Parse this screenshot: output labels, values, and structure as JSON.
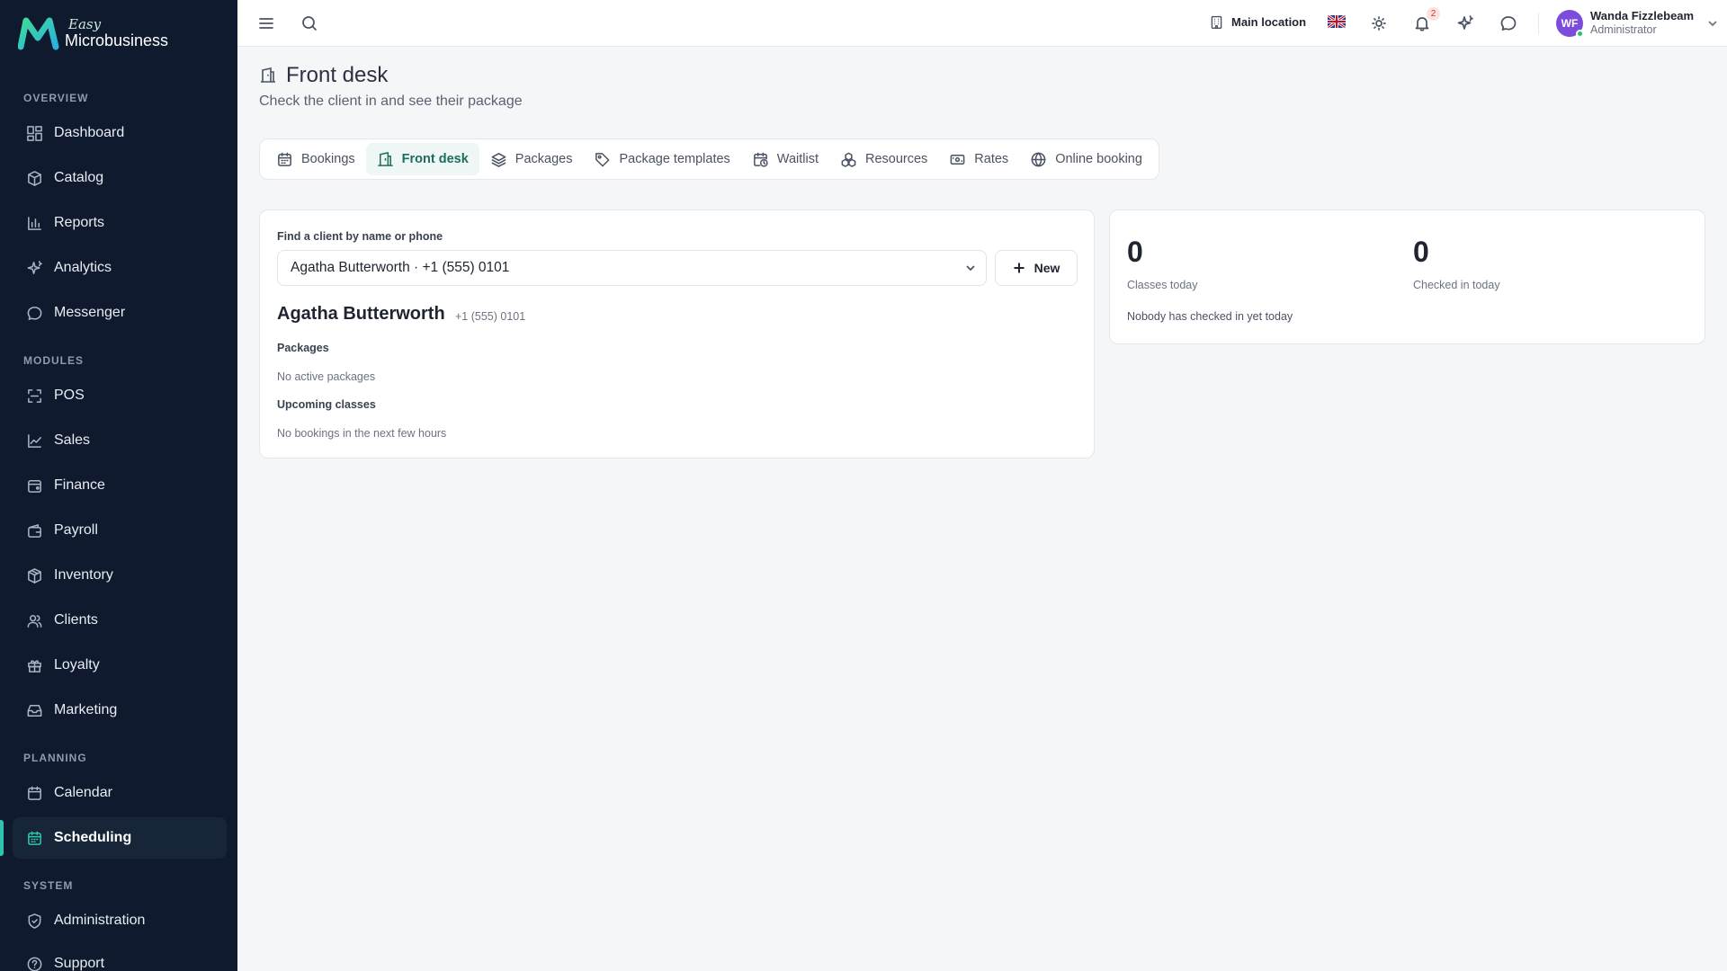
{
  "brand": {
    "easy": "Easy",
    "name": "Microbusiness"
  },
  "sidebar": {
    "sections": {
      "overview": "OVERVIEW",
      "modules": "MODULES",
      "planning": "PLANNING",
      "system": "SYSTEM"
    },
    "items": [
      {
        "label": "Dashboard",
        "icon": "dashboard-icon"
      },
      {
        "label": "Catalog",
        "icon": "catalog-icon"
      },
      {
        "label": "Reports",
        "icon": "reports-icon"
      },
      {
        "label": "Analytics",
        "icon": "analytics-icon"
      },
      {
        "label": "Messenger",
        "icon": "messenger-icon"
      },
      {
        "label": "POS",
        "icon": "pos-icon"
      },
      {
        "label": "Sales",
        "icon": "sales-icon"
      },
      {
        "label": "Finance",
        "icon": "finance-icon"
      },
      {
        "label": "Payroll",
        "icon": "payroll-icon"
      },
      {
        "label": "Inventory",
        "icon": "inventory-icon"
      },
      {
        "label": "Clients",
        "icon": "clients-icon"
      },
      {
        "label": "Loyalty",
        "icon": "loyalty-icon"
      },
      {
        "label": "Marketing",
        "icon": "marketing-icon"
      },
      {
        "label": "Calendar",
        "icon": "calendar-icon"
      },
      {
        "label": "Scheduling",
        "icon": "scheduling-icon",
        "active": true
      },
      {
        "label": "Administration",
        "icon": "shield-icon"
      },
      {
        "label": "Support",
        "icon": "help-icon"
      }
    ]
  },
  "topbar": {
    "location": "Main location",
    "notifications_count": "2",
    "user": {
      "initials": "WF",
      "name": "Wanda Fizzlebeam",
      "role": "Administrator"
    }
  },
  "page": {
    "title": "Front desk",
    "subtitle": "Check the client in and see their package"
  },
  "tabs": [
    {
      "label": "Bookings",
      "icon": "calendar-icon"
    },
    {
      "label": "Front desk",
      "icon": "front-desk-icon",
      "active": true
    },
    {
      "label": "Packages",
      "icon": "layers-icon"
    },
    {
      "label": "Package templates",
      "icon": "tag-icon"
    },
    {
      "label": "Waitlist",
      "icon": "calendar-clock-icon"
    },
    {
      "label": "Resources",
      "icon": "resources-icon"
    },
    {
      "label": "Rates",
      "icon": "ticket-icon"
    },
    {
      "label": "Online booking",
      "icon": "globe-icon"
    }
  ],
  "client_search": {
    "label": "Find a client by name or phone",
    "selected": "Agatha Butterworth · +1 (555) 0101",
    "new_button": "New"
  },
  "client": {
    "name": "Agatha Butterworth",
    "phone": "+1 (555) 0101",
    "packages_title": "Packages",
    "packages_text": "No active packages",
    "upcoming_title": "Upcoming classes",
    "upcoming_text": "No bookings in the next few hours"
  },
  "stats": {
    "classes_today": {
      "value": "0",
      "label": "Classes today"
    },
    "checked_in_today": {
      "value": "0",
      "label": "Checked in today"
    },
    "note": "Nobody has checked in yet today"
  },
  "colors": {
    "sidebar_bg": "#0f1a2e",
    "accent": "#2ec4b0",
    "active_tab_text": "#1e6b60"
  }
}
